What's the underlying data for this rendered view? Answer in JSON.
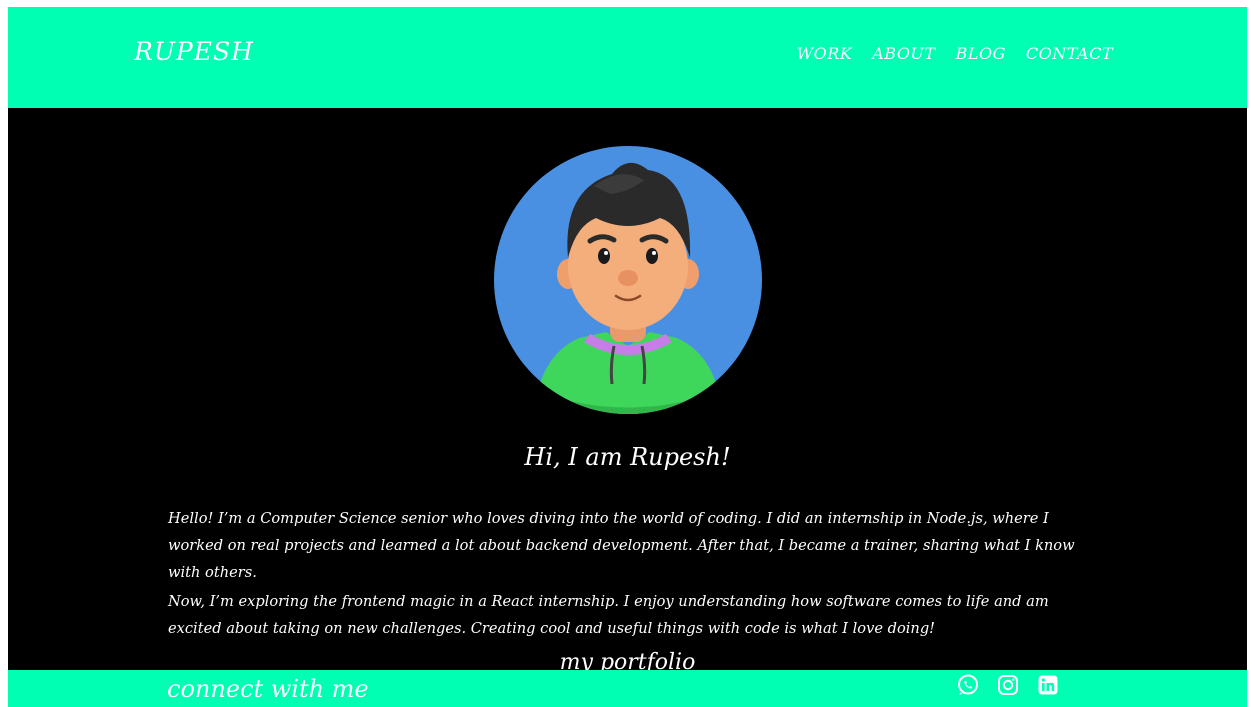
{
  "header": {
    "brand": "RUPESH",
    "nav": [
      "WORK",
      "ABOUT",
      "BLOG",
      "CONTACT"
    ]
  },
  "hero": {
    "greeting": "Hi, I am Rupesh!",
    "bio": [
      "Hello! I’m a Computer Science senior who loves diving into the world of coding. I did an internship in Node.js, where I worked on real projects and learned a lot about backend development. After that, I became a trainer, sharing what I know with others.",
      "Now, I’m exploring the frontend magic in a React internship. I enjoy understanding how software comes to life and am excited about taking on new challenges. Creating cool and useful things with code is what I love doing!"
    ]
  },
  "portfolio": {
    "title": "my portfolio"
  },
  "footer": {
    "text": "connect with me",
    "socials": [
      "whatsapp-icon",
      "instagram-icon",
      "linkedin-icon"
    ]
  },
  "colors": {
    "accent": "#00ffb3",
    "background": "#000000",
    "avatar_bg": "#4a90e2",
    "text": "#ffffff"
  }
}
